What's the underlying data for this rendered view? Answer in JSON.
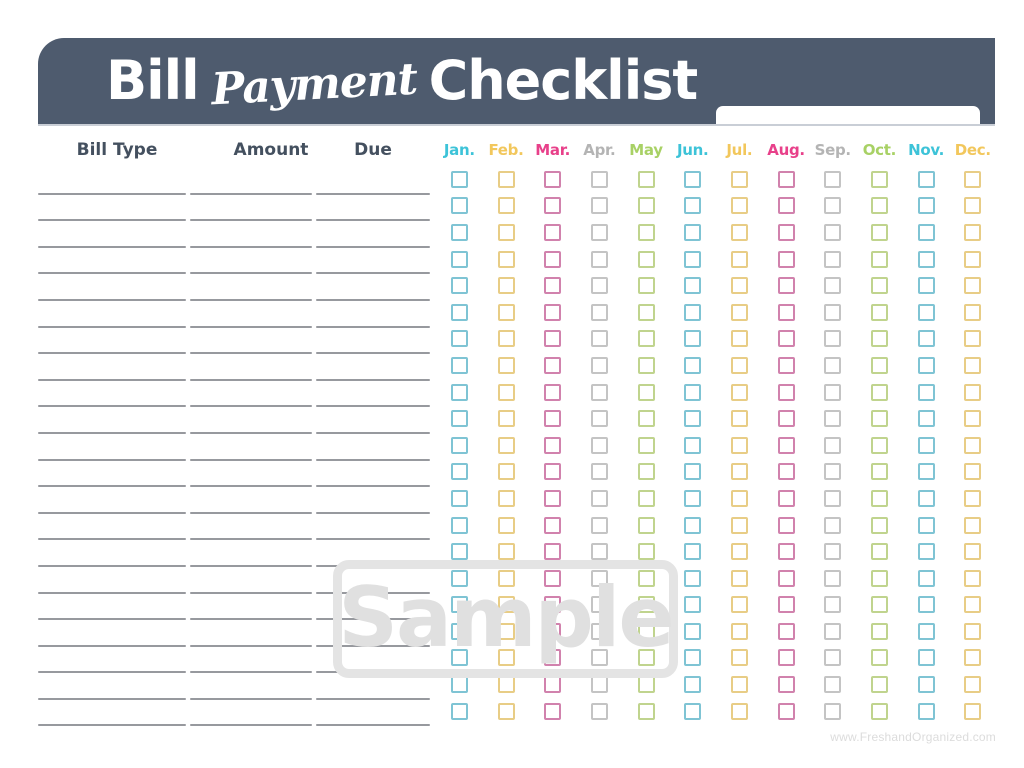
{
  "document": {
    "title_part1": "Bill",
    "title_script": "Payment",
    "title_part2": "Checklist",
    "name_field_value": "",
    "name_field_placeholder": ""
  },
  "colors": {
    "header_bar": "#4e5b6e",
    "header_text": "#ffffff",
    "column_heading": "#44505f",
    "write_line": "#97999e",
    "header_rule": "#c9ced6",
    "watermark": "#e0e0e0",
    "footer": "#dcdcdc",
    "teal": "#3dc3d8",
    "yellow": "#f2c75c",
    "pink": "#e8408a",
    "gray": "#b4b4b4",
    "green": "#a8d165",
    "checkbox_teal": "#7fc4d4",
    "checkbox_yellow": "#e8cd86",
    "checkbox_pink": "#d182ad",
    "checkbox_gray": "#c4c4c4",
    "checkbox_green": "#c0d48e"
  },
  "left_columns": [
    {
      "label": "Bill Type"
    },
    {
      "label": "Amount"
    },
    {
      "label": "Due"
    }
  ],
  "months": [
    {
      "label": "Jan.",
      "color": "#3dc3d8",
      "box_color": "#7fc4d4"
    },
    {
      "label": "Feb.",
      "color": "#f2c75c",
      "box_color": "#e8cd86"
    },
    {
      "label": "Mar.",
      "color": "#e8408a",
      "box_color": "#d182ad"
    },
    {
      "label": "Apr.",
      "color": "#b4b4b4",
      "box_color": "#c4c4c4"
    },
    {
      "label": "May",
      "color": "#a8d165",
      "box_color": "#c0d48e"
    },
    {
      "label": "Jun.",
      "color": "#3dc3d8",
      "box_color": "#7fc4d4"
    },
    {
      "label": "Jul.",
      "color": "#f2c75c",
      "box_color": "#e8cd86"
    },
    {
      "label": "Aug.",
      "color": "#e8408a",
      "box_color": "#d182ad"
    },
    {
      "label": "Sep.",
      "color": "#b4b4b4",
      "box_color": "#c4c4c4"
    },
    {
      "label": "Oct.",
      "color": "#a8d165",
      "box_color": "#c0d48e"
    },
    {
      "label": "Nov.",
      "color": "#3dc3d8",
      "box_color": "#7fc4d4"
    },
    {
      "label": "Dec.",
      "color": "#f2c75c",
      "box_color": "#e8cd86"
    }
  ],
  "grid": {
    "row_count": 21,
    "checked_cells": []
  },
  "watermark": {
    "text": "Sample"
  },
  "footer": {
    "credit": "www.FreshandOrganized.com"
  }
}
